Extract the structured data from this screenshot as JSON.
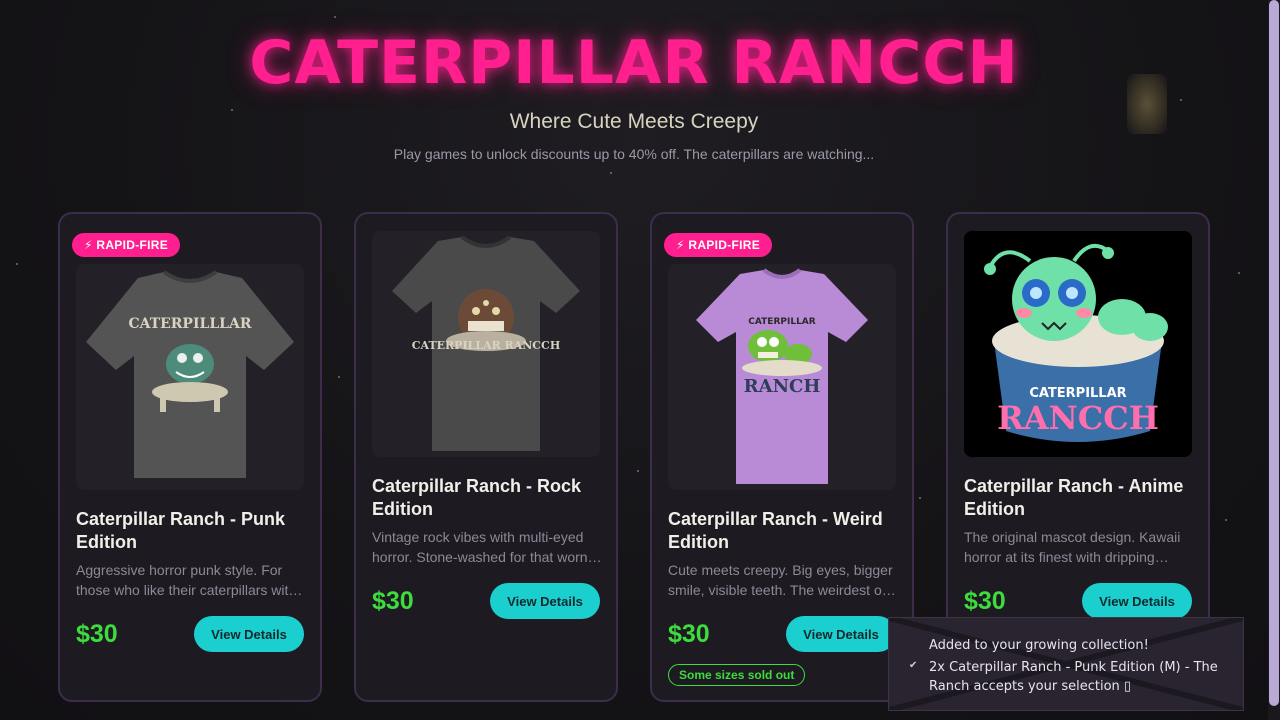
{
  "header": {
    "title": "CATERPILLAR RANCCH",
    "subtitle": "Where Cute Meets Creepy",
    "tagline": "Play games to unlock discounts up to 40% off. The caterpillars are watching..."
  },
  "products": [
    {
      "badge": "⚡ RAPID-FIRE",
      "title": "Caterpillar Ranch - Punk Edition",
      "description": "Aggressive horror punk style. For those who like their caterpillars with attitude.",
      "price": "$30",
      "button": "View Details",
      "shirt_color": "#555454",
      "image_text": "CATERPILLLAR"
    },
    {
      "title": "Caterpillar Ranch - Rock Edition",
      "description": "Vintage rock vibes with multi-eyed horror. Stone-washed for that worn-in look.",
      "price": "$30",
      "button": "View Details",
      "shirt_color": "#4a4a4a",
      "image_text": "CATERPILLAR RANCCH"
    },
    {
      "badge": "⚡ RAPID-FIRE",
      "title": "Caterpillar Ranch - Weird Edition",
      "description": "Cute meets creepy. Big eyes, bigger smile, visible teeth. The weirdest one yet.",
      "price": "$30",
      "button": "View Details",
      "stock_note": "Some sizes sold out",
      "shirt_color": "#b98ad6",
      "image_text_top": "CATERPILLAR",
      "image_text_bottom": "RANCH"
    },
    {
      "title": "Caterpillar Ranch - Anime Edition",
      "description": "The original mascot design. Kawaii horror at its finest with dripping ranch.",
      "price": "$30",
      "button": "View Details",
      "image_text_top": "CATERPILLAR",
      "image_text_bottom": "RANCCH"
    }
  ],
  "toast": {
    "line1": "Added to your growing collection!",
    "line2": "2x Caterpillar Ranch - Punk Edition (M) - The Ranch accepts your selection ▯",
    "check": "✔"
  },
  "colors": {
    "accent_pink": "#ff1f8e",
    "price_green": "#3ddc3d",
    "button_cyan": "#1ccfcf"
  }
}
